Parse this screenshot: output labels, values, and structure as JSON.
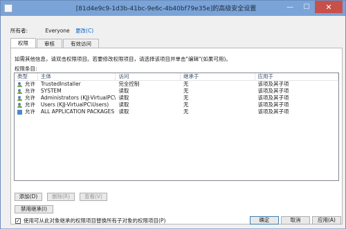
{
  "window": {
    "title": "[81d4e9c9-1d3b-41bc-9e6c-4b40bf79e35e]的高级安全设置",
    "min_glyph": "—",
    "max_glyph": "☐",
    "close_glyph": "✕"
  },
  "owner": {
    "label": "所有者:",
    "value": "Everyone",
    "change_link": "更改(C)"
  },
  "tabs": [
    {
      "label": "权限",
      "active": true
    },
    {
      "label": "审核",
      "active": false
    },
    {
      "label": "有效访问",
      "active": false
    }
  ],
  "permissions": {
    "note": "如需其他信息，请双击权限项目。若要修改权限项目，请选择该项目并单击\"编辑\"(如果可用)。",
    "entries_label": "权限条目:",
    "columns": [
      "类型",
      "主体",
      "访问",
      "继承于",
      "应用于"
    ],
    "rows": [
      {
        "type": "允许",
        "principal": "TrustedInstaller",
        "access": "完全控制",
        "inherited": "无",
        "applies": "该项及其子项"
      },
      {
        "type": "允许",
        "principal": "SYSTEM",
        "access": "读取",
        "inherited": "无",
        "applies": "该项及其子项"
      },
      {
        "type": "允许",
        "principal": "Administrators (KJJ-VirtualPC\\Ad...",
        "access": "读取",
        "inherited": "无",
        "applies": "该项及其子项"
      },
      {
        "type": "允许",
        "principal": "Users (KJJ-VirtualPC\\Users)",
        "access": "读取",
        "inherited": "无",
        "applies": "该项及其子项"
      },
      {
        "type": "允许",
        "principal": "ALL APPLICATION PACKAGES",
        "access": "读取",
        "inherited": "无",
        "applies": "该项及其子项"
      }
    ],
    "add_button": "添加(D)",
    "remove_button": "删除(R)",
    "view_button": "查看(V)",
    "disable_inheritance_button": "禁用继承(I)",
    "replace_checkbox_label": "使用可从此对象继承的权限项目替换所有子对象的权限项目(P)",
    "replace_checked": true
  },
  "footer": {
    "ok": "确定",
    "cancel": "取消",
    "apply": "应用(A)"
  }
}
